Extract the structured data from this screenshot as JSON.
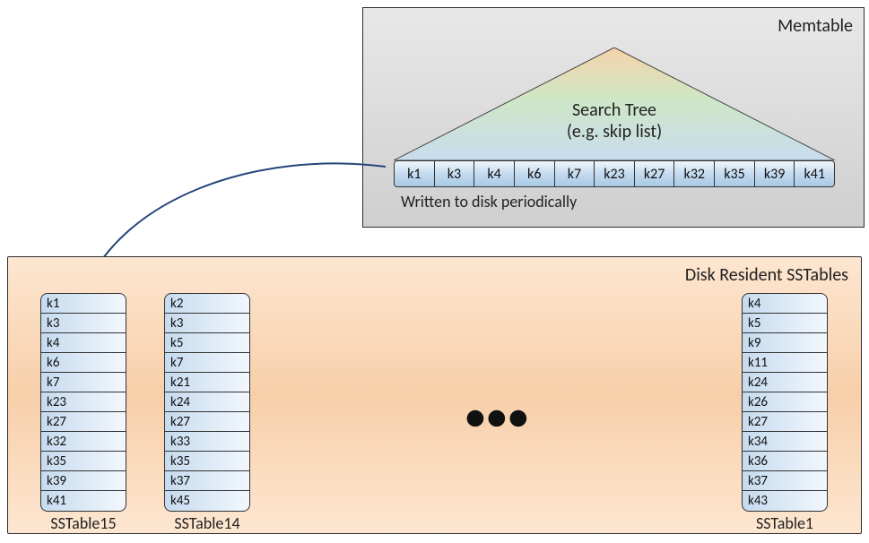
{
  "memtable": {
    "title": "Memtable",
    "tree_label_1": "Search Tree",
    "tree_label_2": "(e.g. skip list)",
    "keys": [
      "k1",
      "k3",
      "k4",
      "k6",
      "k7",
      "k23",
      "k27",
      "k32",
      "k35",
      "k39",
      "k41"
    ],
    "footer": "Written to disk periodically"
  },
  "disk": {
    "title": "Disk Resident SSTables",
    "ellipsis": "•••",
    "tables": {
      "t15": {
        "label": "SSTable15",
        "keys": [
          "k1",
          "k3",
          "k4",
          "k6",
          "k7",
          "k23",
          "k27",
          "k32",
          "k35",
          "k39",
          "k41"
        ]
      },
      "t14": {
        "label": "SSTable14",
        "keys": [
          "k2",
          "k3",
          "k5",
          "k7",
          "k21",
          "k24",
          "k27",
          "k33",
          "k35",
          "k37",
          "k45"
        ]
      },
      "t1": {
        "label": "SSTable1",
        "keys": [
          "k4",
          "k5",
          "k9",
          "k11",
          "k24",
          "k26",
          "k27",
          "k34",
          "k36",
          "k37",
          "k43"
        ]
      }
    }
  }
}
